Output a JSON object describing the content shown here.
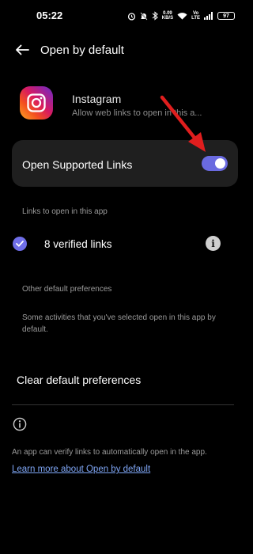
{
  "status_bar": {
    "time": "05:22",
    "net_speed_value": "0.09",
    "net_speed_unit": "KB/S",
    "network_top": "Vo",
    "network_bottom": "LTE",
    "battery": "97"
  },
  "header": {
    "title": "Open by default"
  },
  "app": {
    "name": "Instagram",
    "subtitle": "Allow web links to open in this a..."
  },
  "supported_links": {
    "label": "Open Supported Links",
    "enabled": true
  },
  "links_section": {
    "header": "Links to open in this app",
    "verified_label": "8 verified links"
  },
  "other_section": {
    "header": "Other default preferences",
    "description": "Some activities that you've selected open in this app by default."
  },
  "clear_button": "Clear default preferences",
  "footer": {
    "text": "An app can verify links to automatically open in the app.",
    "link": "Learn more about Open by default"
  },
  "colors": {
    "accent": "#6a6ae0",
    "link": "#7fa6f5",
    "annotation_arrow": "#e01e1e"
  },
  "icons": [
    "back-arrow-icon",
    "instagram-icon",
    "check-circle-icon",
    "info-icon",
    "info-outline-icon"
  ]
}
